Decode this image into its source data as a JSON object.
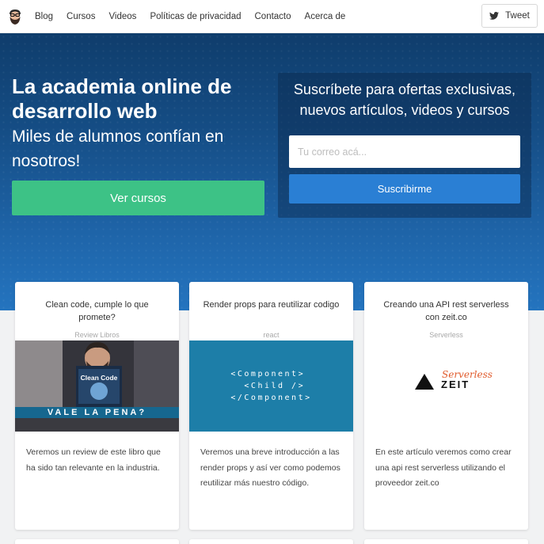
{
  "nav": {
    "logo_icon": "bearded-avatar-icon",
    "links": [
      "Blog",
      "Cursos",
      "Videos",
      "Políticas de privacidad",
      "Contacto",
      "Acerca de"
    ],
    "tweet_label": "Tweet",
    "tweet_icon": "twitter-bird-icon"
  },
  "hero": {
    "title": "La academia online de desarrollo web",
    "subtitle": "Miles de alumnos confían en nosotros!",
    "cta_label": "Ver cursos"
  },
  "subscribe": {
    "title": "Suscríbete para ofertas exclusivas, nuevos artículos, videos y cursos",
    "placeholder": "Tu correo acá...",
    "button_label": "Suscribirme"
  },
  "cards": [
    {
      "title": "Clean code, cumple lo que promete?",
      "tag": "Review Libros",
      "image_book_title": "Clean Code",
      "image_banner": "VALE LA PENA?",
      "description": "Veremos un review de este libro que ha sido tan relevante en la industria."
    },
    {
      "title": "Render props para reutilizar codigo",
      "tag": "react",
      "image_code": "<Component>\n  <Child />\n</Component>",
      "description": "Veremos una breve introducción a las render props y así ver como podemos reutilizar más nuestro código."
    },
    {
      "title": "Creando una API rest serverless con zeit.co",
      "tag": "Serverless",
      "image_logo_script": "Serverless",
      "image_logo_text": "ZEIT",
      "description": "En este artículo veremos como crear una api rest serverless utilizando el proveedor zeit.co"
    }
  ],
  "colors": {
    "accent_green": "#3dc286",
    "accent_blue": "#2a7fd4",
    "hero_blue": "#1f64a5",
    "serverless_red": "#e05a2b"
  }
}
